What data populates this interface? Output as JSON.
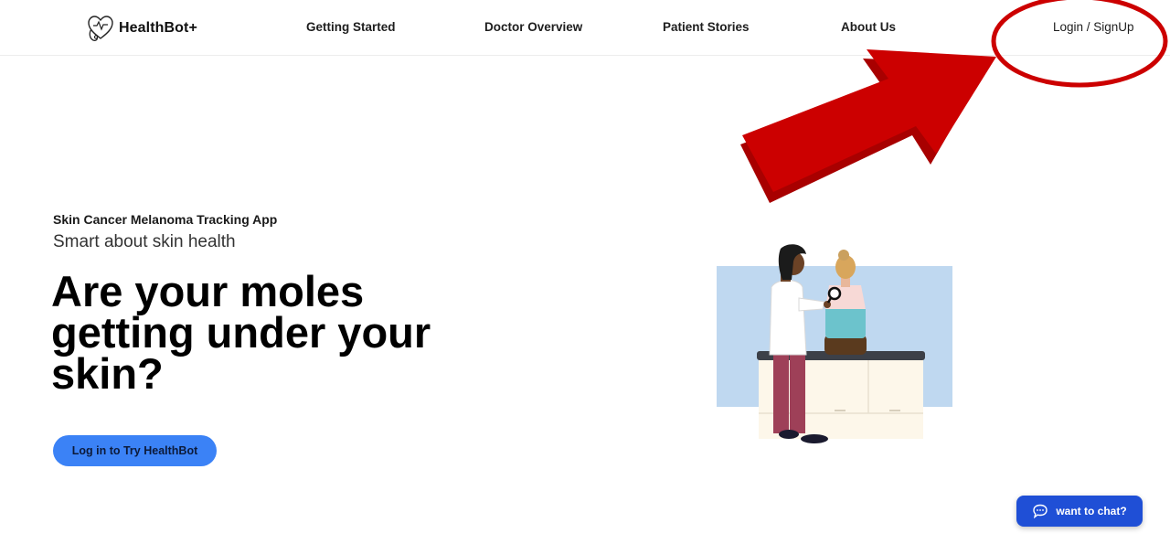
{
  "nav": {
    "logo_text": "HealthBot+",
    "links": [
      {
        "label": "Getting Started"
      },
      {
        "label": "Doctor Overview"
      },
      {
        "label": "Patient Stories"
      },
      {
        "label": "About Us"
      }
    ],
    "login_label": "Login / SignUp"
  },
  "hero": {
    "eyebrow": "Skin Cancer Melanoma Tracking App",
    "tagline": "Smart about skin health",
    "headline": "Are your moles getting under your skin?",
    "cta_label": "Log in to Try HealthBot"
  },
  "chat": {
    "label": "want to chat?"
  },
  "colors": {
    "accent": "#3b82f6",
    "chat_button": "#1f4fd6",
    "annotation": "#cc0000"
  },
  "icons": {
    "logo": "heart-stethoscope-icon",
    "chat": "chat-bubble-icon"
  }
}
